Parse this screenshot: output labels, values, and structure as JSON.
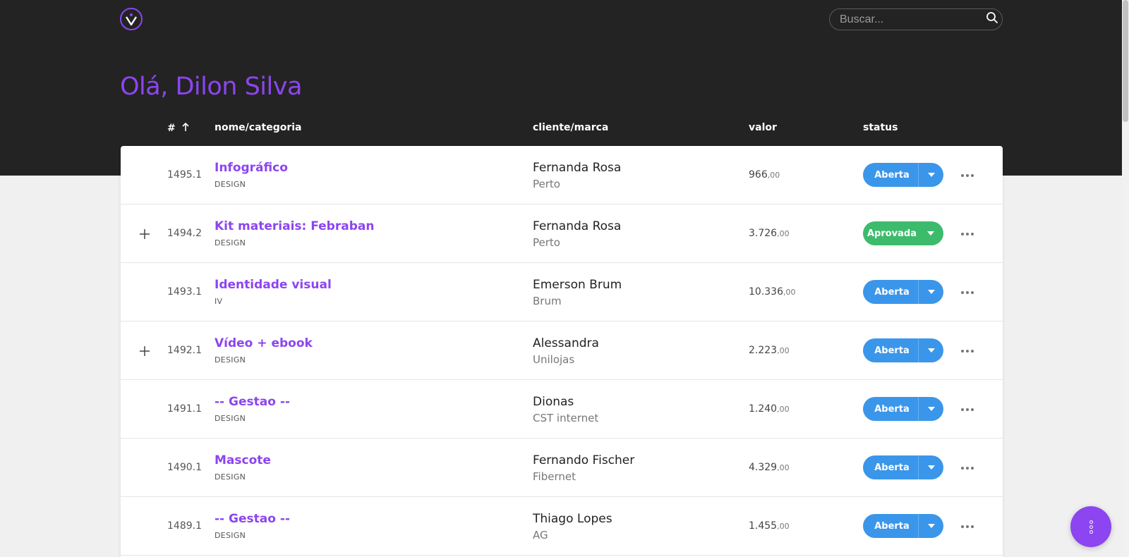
{
  "header": {
    "logo": "v-logo-icon",
    "search": {
      "placeholder": "Buscar...",
      "value": "",
      "icon": "search-icon"
    }
  },
  "greeting": "Olá, Dilon Silva",
  "table": {
    "columns": {
      "number": "#",
      "sort_icon": "arrow-up-icon",
      "name": "nome/categoria",
      "client": "cliente/marca",
      "value": "valor",
      "status": "status"
    },
    "rows": [
      {
        "expandable": false,
        "number": "1495.1",
        "name": "Infográfico",
        "category": "DESIGN",
        "client": "Fernanda Rosa",
        "brand": "Perto",
        "value": "966",
        "cents": ",00",
        "status": "Aberta",
        "status_color": "#3a96ea"
      },
      {
        "expandable": true,
        "number": "1494.2",
        "name": "Kit materiais: Febraban",
        "category": "DESIGN",
        "client": "Fernanda Rosa",
        "brand": "Perto",
        "value": "3.726",
        "cents": ",00",
        "status": "Aprovada",
        "status_color": "#3dbb6c"
      },
      {
        "expandable": false,
        "number": "1493.1",
        "name": "Identidade visual",
        "category": "IV",
        "client": "Emerson Brum",
        "brand": "Brum",
        "value": "10.336",
        "cents": ",00",
        "status": "Aberta",
        "status_color": "#3a96ea"
      },
      {
        "expandable": true,
        "number": "1492.1",
        "name": "Vídeo + ebook",
        "category": "DESIGN",
        "client": "Alessandra",
        "brand": "Unilojas",
        "value": "2.223",
        "cents": ",00",
        "status": "Aberta",
        "status_color": "#3a96ea"
      },
      {
        "expandable": false,
        "number": "1491.1",
        "name": "-- Gestao --",
        "category": "DESIGN",
        "client": "Dionas",
        "brand": "CST internet",
        "value": "1.240",
        "cents": ",00",
        "status": "Aberta",
        "status_color": "#3a96ea"
      },
      {
        "expandable": false,
        "number": "1490.1",
        "name": "Mascote",
        "category": "DESIGN",
        "client": "Fernando Fischer",
        "brand": "Fibernet",
        "value": "4.329",
        "cents": ",00",
        "status": "Aberta",
        "status_color": "#3a96ea"
      },
      {
        "expandable": false,
        "number": "1489.1",
        "name": "-- Gestao --",
        "category": "DESIGN",
        "client": "Thiago Lopes",
        "brand": "AG",
        "value": "1.455",
        "cents": ",00",
        "status": "Aberta",
        "status_color": "#3a96ea"
      }
    ]
  },
  "fab": {
    "icon": "more-vertical-icon"
  },
  "colors": {
    "accent": "#8c45f0",
    "header_bg": "#232323",
    "status_open": "#3a96ea",
    "status_approved": "#3dbb6c"
  }
}
